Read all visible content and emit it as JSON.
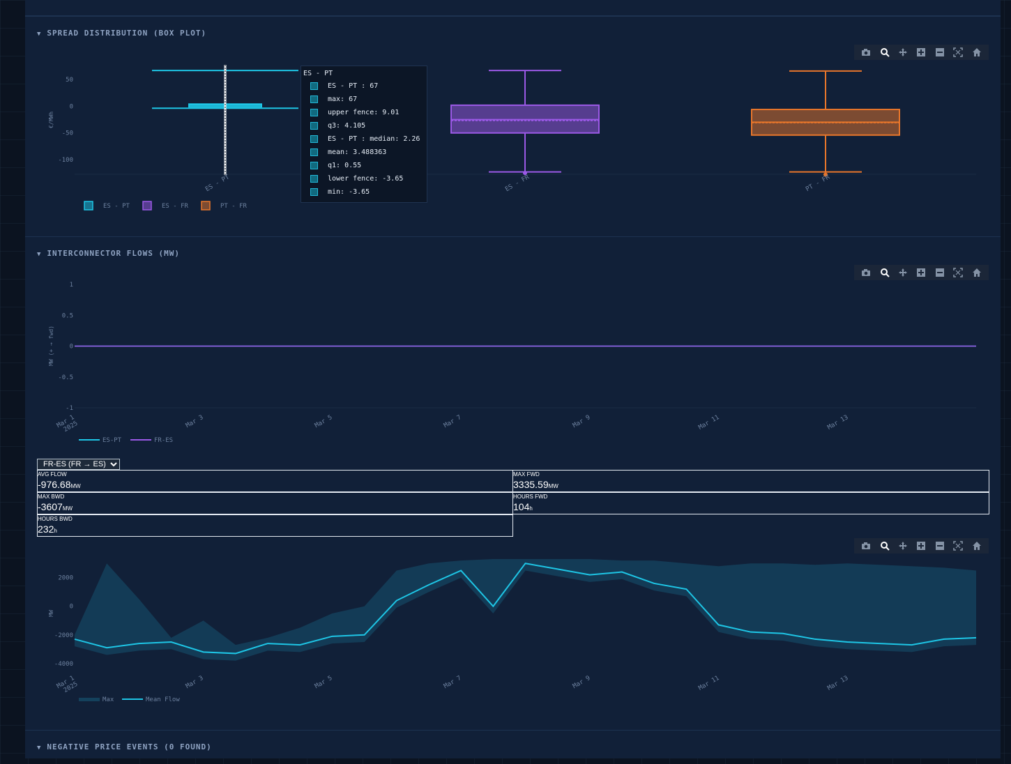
{
  "sections": {
    "spread": {
      "title": "SPREAD DISTRIBUTION (BOX PLOT)",
      "caret": "▼"
    },
    "flows": {
      "title": "INTERCONNECTOR FLOWS (MW)",
      "caret": "▼"
    },
    "negative": {
      "title": "NEGATIVE PRICE EVENTS (0 FOUND)",
      "caret": "▼"
    }
  },
  "modebar_icons": [
    "camera-icon",
    "zoom-icon",
    "pan-icon",
    "zoom-in-icon",
    "zoom-out-icon",
    "autoscale-icon",
    "reset-axes-icon"
  ],
  "tooltip": {
    "title": "ES - PT",
    "rows": [
      "ES - PT : 67",
      "max: 67",
      "upper fence: 9.01",
      "q3: 4.105",
      "ES - PT : median: 2.26",
      "mean: 3.488363",
      "q1: 0.55",
      "lower fence: -3.65",
      "min: -3.65"
    ]
  },
  "flow_selector": {
    "selected": "FR-ES (FR → ES)"
  },
  "stats": {
    "avg_flow": {
      "label": "AVG FLOW",
      "value": "-976.68",
      "unit": "MW"
    },
    "max_fwd": {
      "label": "MAX FWD",
      "value": "3335.59",
      "unit": "MW"
    },
    "max_bwd": {
      "label": "MAX BWD",
      "value": "-3607",
      "unit": "MW"
    },
    "hours_fwd": {
      "label": "HOURS FWD",
      "value": "104",
      "unit": "h"
    },
    "hours_bwd": {
      "label": "HOURS BWD",
      "value": "232",
      "unit": "h"
    }
  },
  "chart_data": [
    {
      "type": "box",
      "ylabel": "€/MWh",
      "yticks": [
        50,
        0,
        -50,
        -100
      ],
      "ylim": [
        -130,
        75
      ],
      "legend_placement": "bottom-left",
      "series": [
        {
          "name": "ES - PT",
          "color": "#1ec6e6",
          "min": -3.65,
          "lower_fence": -3.65,
          "q1": 0.55,
          "median": 2.26,
          "mean": 3.488363,
          "q3": 4.105,
          "upper_fence": 9.01,
          "max": 67
        },
        {
          "name": "ES - FR",
          "color": "#9b59e6",
          "min": -125,
          "lower_fence": -123,
          "q1": -50,
          "median": -25,
          "mean": -27,
          "q3": 2,
          "upper_fence": 67,
          "max": 67
        },
        {
          "name": "PT - FR",
          "color": "#e8762b",
          "min": -128,
          "lower_fence": -123,
          "q1": -54,
          "median": -30,
          "mean": -31,
          "q3": -6,
          "upper_fence": 66,
          "max": 66
        }
      ]
    },
    {
      "type": "line",
      "ylabel": "MW (+ → fwd)",
      "yticks": [
        1,
        0.5,
        0,
        -0.5,
        -1
      ],
      "ylim": [
        -1,
        1
      ],
      "x_ticks": [
        "Mar 1\n2025",
        "Mar 3",
        "Mar 5",
        "Mar 7",
        "Mar 9",
        "Mar 11",
        "Mar 13"
      ],
      "legend_placement": "bottom-left",
      "series": [
        {
          "name": "ES-PT",
          "color": "#1ec6e6",
          "values": [
            0,
            0
          ]
        },
        {
          "name": "FR-ES",
          "color": "#9b59e6",
          "values": [
            0,
            0
          ]
        }
      ]
    },
    {
      "type": "area",
      "ylabel": "MW",
      "yticks": [
        2000,
        0,
        -2000,
        -4000
      ],
      "ylim": [
        -4400,
        3400
      ],
      "x_ticks": [
        "Mar 1\n2025",
        "Mar 3",
        "Mar 5",
        "Mar 7",
        "Mar 9",
        "Mar 11",
        "Mar 13"
      ],
      "legend_placement": "bottom-left",
      "series": [
        {
          "name": "Max",
          "color": "#14415c"
        },
        {
          "name": "Mean Flow",
          "color": "#1ec6e6"
        }
      ],
      "x_days": [
        1.0,
        1.5,
        2.0,
        2.5,
        3.0,
        3.5,
        4.0,
        4.5,
        5.0,
        5.5,
        6.0,
        6.5,
        7.0,
        7.5,
        8.0,
        8.5,
        9.0,
        9.5,
        10.0,
        10.5,
        11.0,
        11.5,
        12.0,
        12.5,
        13.0,
        13.5,
        14.0,
        14.5,
        15.0
      ],
      "mean": [
        -2300,
        -2900,
        -2600,
        -2500,
        -3200,
        -3300,
        -2600,
        -2700,
        -2100,
        -2000,
        400,
        1500,
        2500,
        0,
        3000,
        2600,
        2200,
        2400,
        1600,
        1200,
        -1300,
        -1800,
        -1900,
        -2300,
        -2500,
        -2600,
        -2700,
        -2300,
        -2200
      ],
      "max": [
        -2000,
        3000,
        500,
        -2200,
        -1000,
        -2700,
        -2200,
        -1500,
        -500,
        0,
        2500,
        3000,
        3200,
        3300,
        3300,
        3300,
        3300,
        3200,
        3200,
        3000,
        2800,
        3000,
        3000,
        2900,
        3000,
        2900,
        2800,
        2700,
        2500
      ]
    }
  ]
}
